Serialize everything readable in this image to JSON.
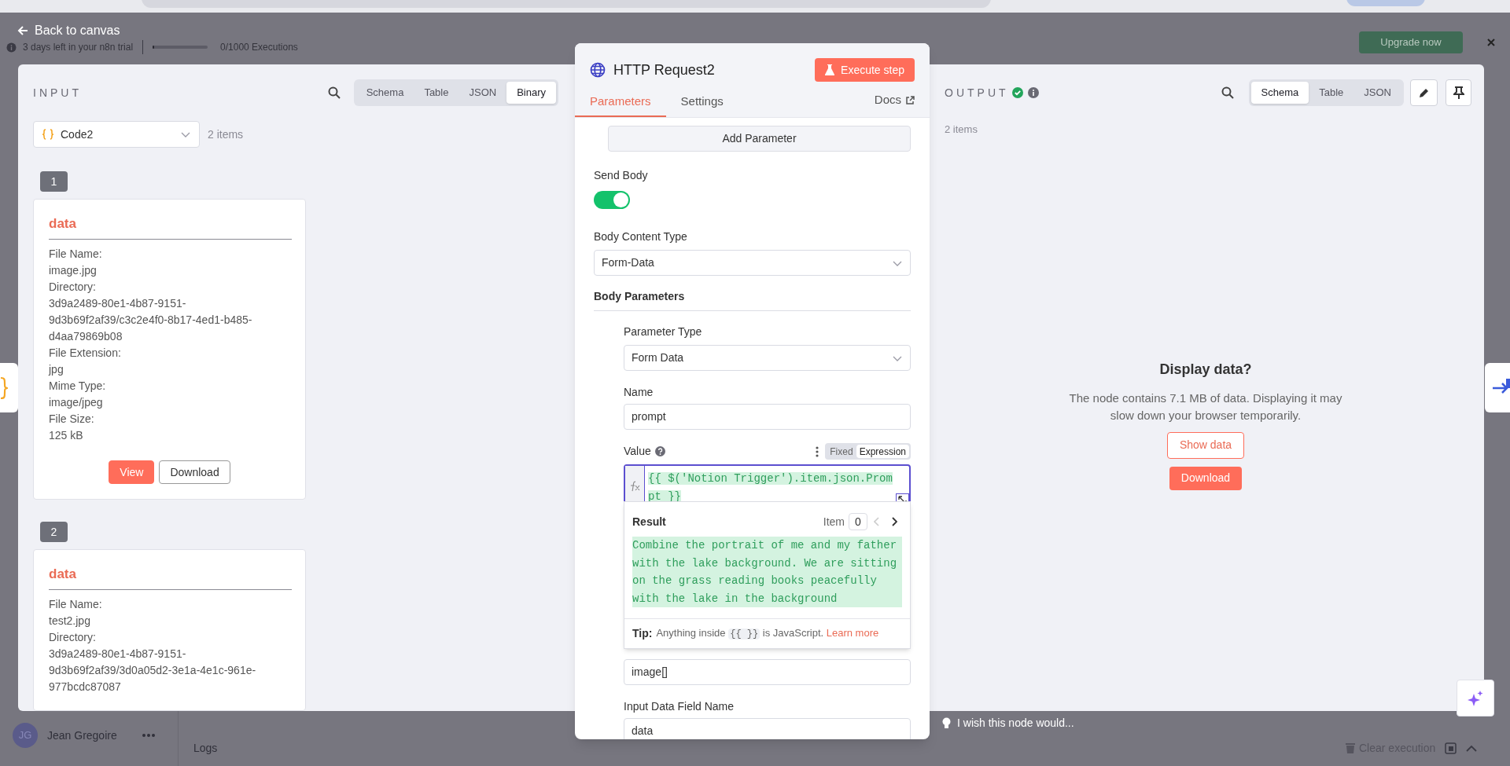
{
  "background": {
    "trial_text": "3 days left in your n8n trial",
    "executions_meter": {
      "level": 0.03
    },
    "executions_text": "0/1000 Executions",
    "upgrade_button": "Upgrade now",
    "user": {
      "initials": "JG",
      "name": "Jean Gregoire"
    },
    "logs_label": "Logs",
    "clear_execution": "Clear execution"
  },
  "back_link": "Back to canvas",
  "input_panel": {
    "title": "INPUT",
    "view_tabs": [
      {
        "label": "Schema",
        "selected": false
      },
      {
        "label": "Table",
        "selected": false
      },
      {
        "label": "JSON",
        "selected": false
      },
      {
        "label": "Binary",
        "selected": true
      }
    ],
    "node_select": "Code2",
    "item_count": "2 items",
    "items": [
      {
        "index": "1",
        "key": "data",
        "fields": [
          {
            "label": "File Name:",
            "value": "image.jpg"
          },
          {
            "label": "Directory:",
            "value": "3d9a2489-80e1-4b87-9151-9d3b69f2af39/c3c2e4f0-8b17-4ed1-b485-d4aa79869b08"
          },
          {
            "label": "File Extension:",
            "value": "jpg"
          },
          {
            "label": "Mime Type:",
            "value": "image/jpeg"
          },
          {
            "label": "File Size:",
            "value": "125 kB"
          }
        ],
        "buttons": [
          {
            "label": "View",
            "kind": "primary"
          },
          {
            "label": "Download",
            "kind": "secondary"
          }
        ]
      },
      {
        "index": "2",
        "key": "data",
        "fields": [
          {
            "label": "File Name:",
            "value": "test2.jpg"
          },
          {
            "label": "Directory:",
            "value": "3d9a2489-80e1-4b87-9151-9d3b69f2af39/3d0a05d2-3e1a-4e1c-961e-977bcdc87087"
          }
        ]
      }
    ]
  },
  "node_panel": {
    "title": "HTTP Request2",
    "execute_button": "Execute step",
    "tabs": [
      {
        "label": "Parameters",
        "selected": true
      },
      {
        "label": "Settings",
        "selected": false
      }
    ],
    "docs_link": "Docs",
    "parameters": [
      {
        "kind": "button",
        "label": "Add Parameter"
      },
      {
        "kind": "toggle",
        "label": "Send Body",
        "on": true
      },
      {
        "kind": "select",
        "label": "Body Content Type",
        "value": "Form-Data"
      },
      {
        "kind": "section",
        "label": "Body Parameters",
        "children": [
          {
            "kind": "select",
            "label": "Parameter Type",
            "value": "Form Data"
          },
          {
            "kind": "text",
            "label": "Name",
            "value": "prompt"
          },
          {
            "kind": "expression",
            "label": "Value",
            "modes": [
              {
                "label": "Fixed",
                "selected": false
              },
              {
                "label": "Expression",
                "selected": true
              }
            ],
            "value": "{{ $('Notion Trigger').item.json.Prompt }}",
            "result": {
              "title": "Result",
              "item_label": "Item",
              "item_number": "0",
              "text": "Combine the portrait of me and my father with the lake background. We are sitting on the grass reading books peacefully with the lake in the background",
              "tip_label": "Tip:",
              "tip_before": "Anything inside",
              "tip_code": "{{ }}",
              "tip_after": "is JavaScript.",
              "tip_link": "Learn more"
            }
          },
          {
            "kind": "text",
            "value": "image[]"
          },
          {
            "kind": "text",
            "label": "Input Data Field Name",
            "value": "data"
          }
        ]
      }
    ]
  },
  "output_panel": {
    "title": "OUTPUT",
    "view_tabs": [
      {
        "label": "Schema",
        "selected": true
      },
      {
        "label": "Table",
        "selected": false
      },
      {
        "label": "JSON",
        "selected": false
      }
    ],
    "item_count": "2 items",
    "notice": {
      "title": "Display data?",
      "message": "The node contains 7.1 MB of data. Displaying it may slow down your browser temporarily.",
      "show_button": "Show data",
      "download_button": "Download"
    }
  },
  "feedback_prompt": "I wish this node would..."
}
